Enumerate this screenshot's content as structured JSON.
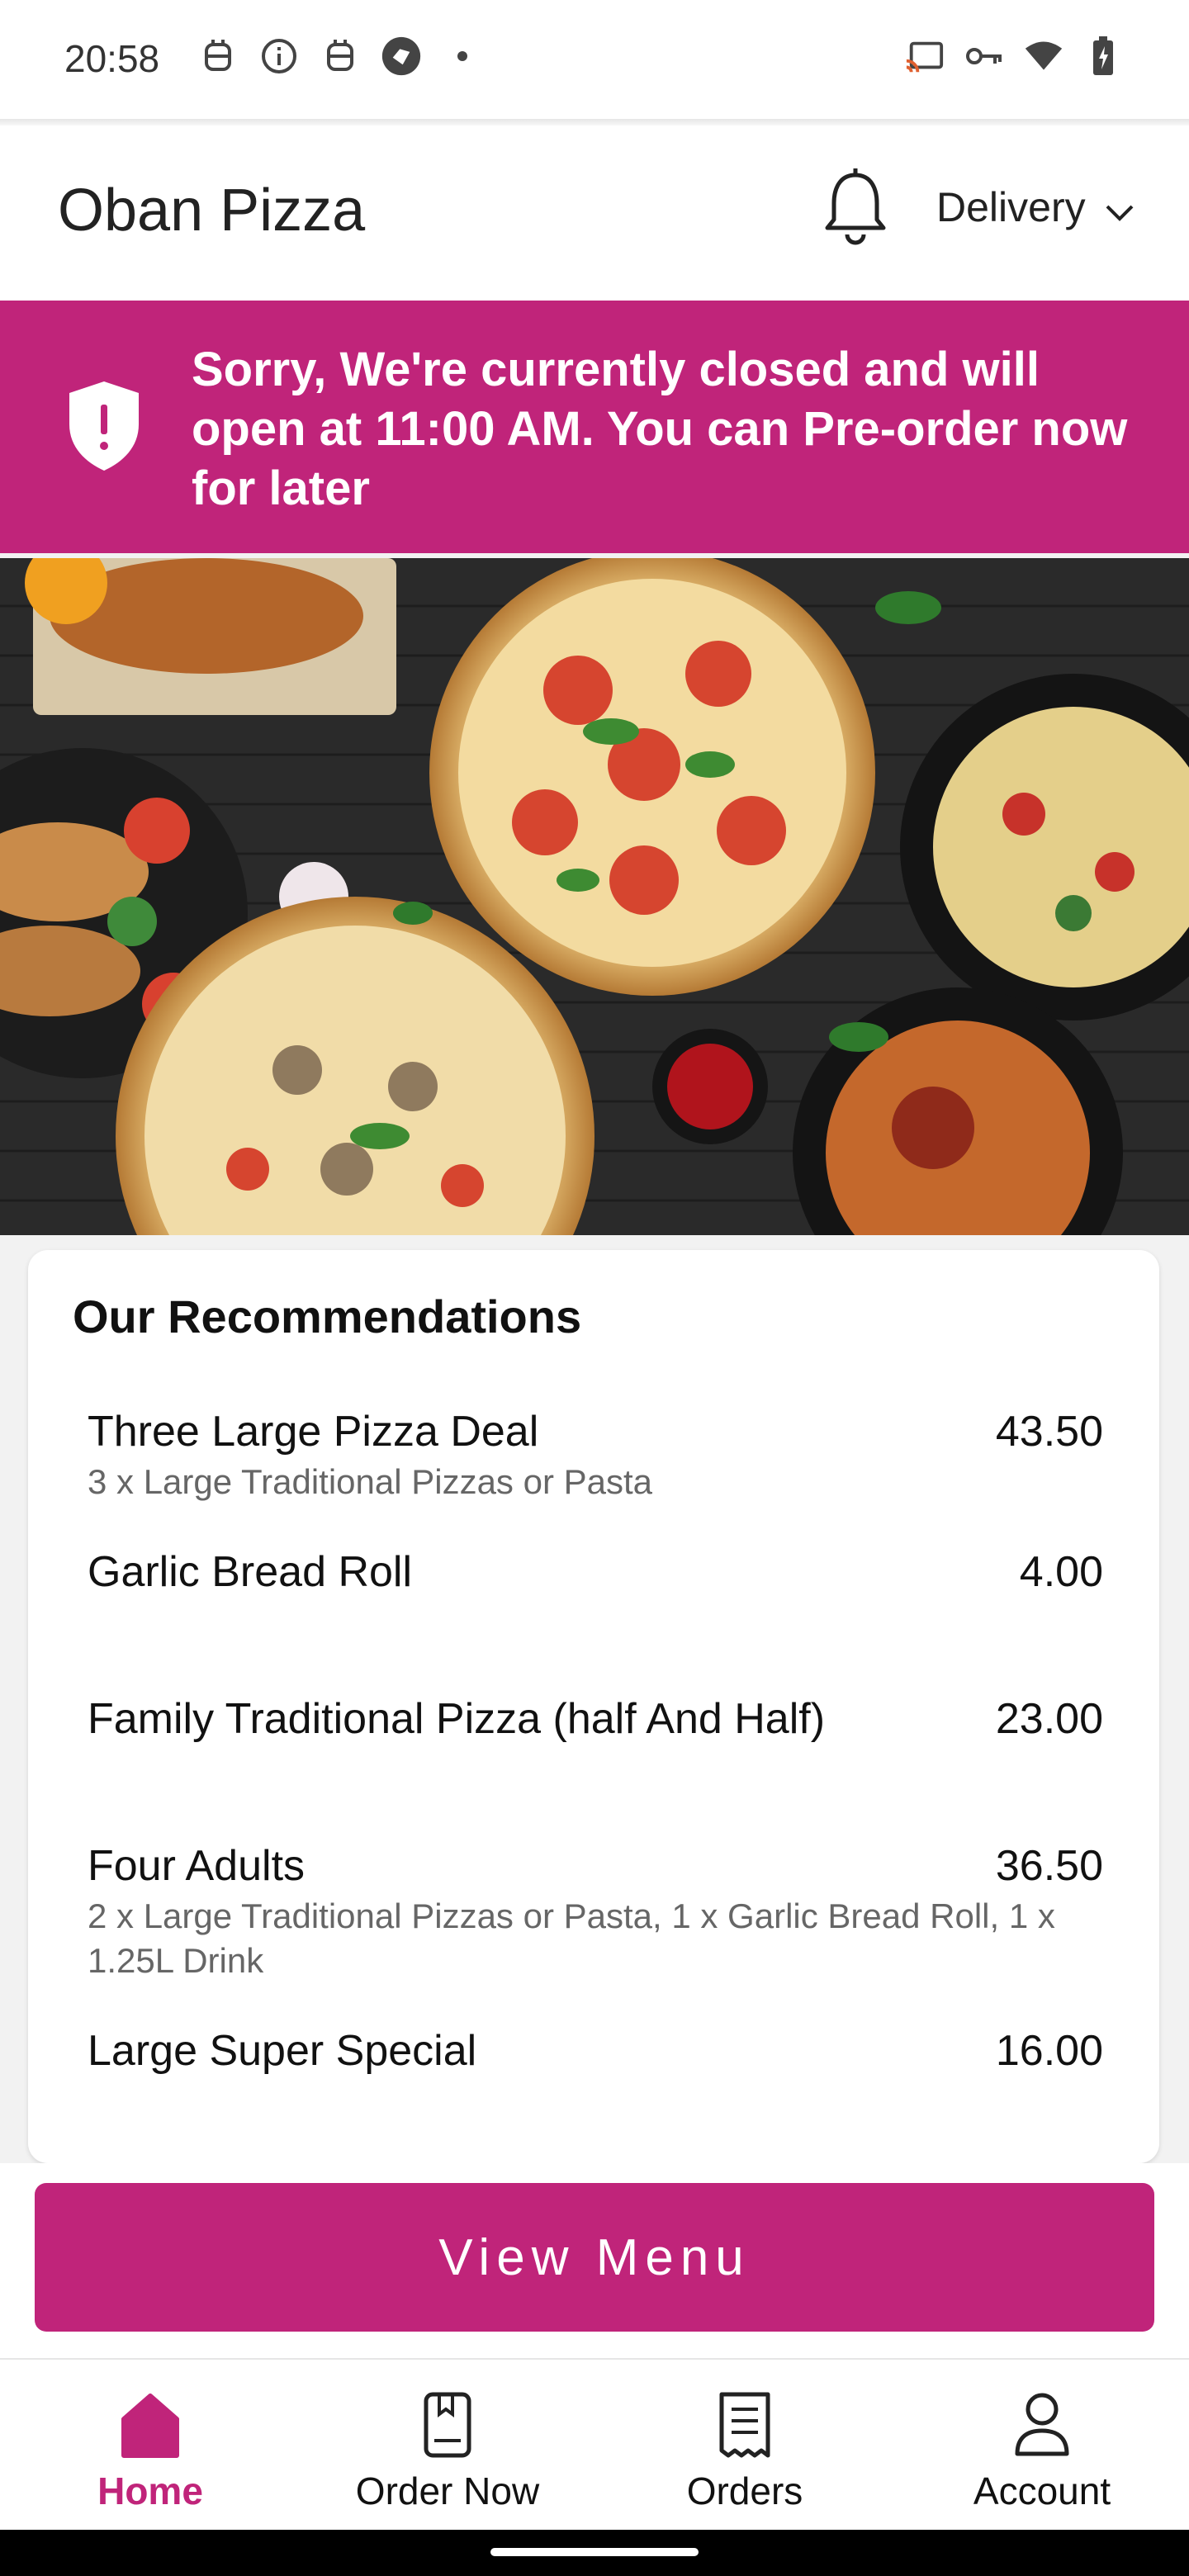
{
  "status_bar": {
    "time": "20:58",
    "left_icons": [
      "robot-icon",
      "info-icon",
      "robot-icon",
      "app-icon",
      "dot-icon"
    ],
    "right_icons": [
      "cast-icon",
      "key-icon",
      "wifi-icon",
      "battery-icon"
    ]
  },
  "app_bar": {
    "title": "Oban Pizza",
    "notification_icon": "bell-icon",
    "order_type": "Delivery"
  },
  "banner": {
    "message": "Sorry, We're currently closed and will open at 11:00 AM. You can Pre-order now for later",
    "icon": "shield-alert-icon"
  },
  "recommendations": {
    "title": "Our Recommendations",
    "items": [
      {
        "name": "Three Large Pizza Deal",
        "price": "43.50",
        "description": "3 x Large Traditional Pizzas or Pasta"
      },
      {
        "name": "Garlic Bread Roll",
        "price": "4.00",
        "description": ""
      },
      {
        "name": "Family Traditional Pizza (half And Half)",
        "price": "23.00",
        "description": ""
      },
      {
        "name": "Four Adults",
        "price": "36.50",
        "description": "2 x Large Traditional Pizzas or Pasta, 1 x Garlic Bread Roll, 1 x 1.25L Drink"
      },
      {
        "name": "Large Super Special",
        "price": "16.00",
        "description": ""
      }
    ]
  },
  "cta": {
    "view_menu_label": "View Menu"
  },
  "bottom_nav": {
    "items": [
      {
        "label": "Home",
        "icon": "home-icon",
        "active": true
      },
      {
        "label": "Order Now",
        "icon": "menu-book-icon",
        "active": false
      },
      {
        "label": "Orders",
        "icon": "receipt-icon",
        "active": false
      },
      {
        "label": "Account",
        "icon": "account-icon",
        "active": false
      }
    ]
  },
  "colors": {
    "brand": "#c0247a",
    "text": "#111111",
    "muted": "#666666"
  }
}
